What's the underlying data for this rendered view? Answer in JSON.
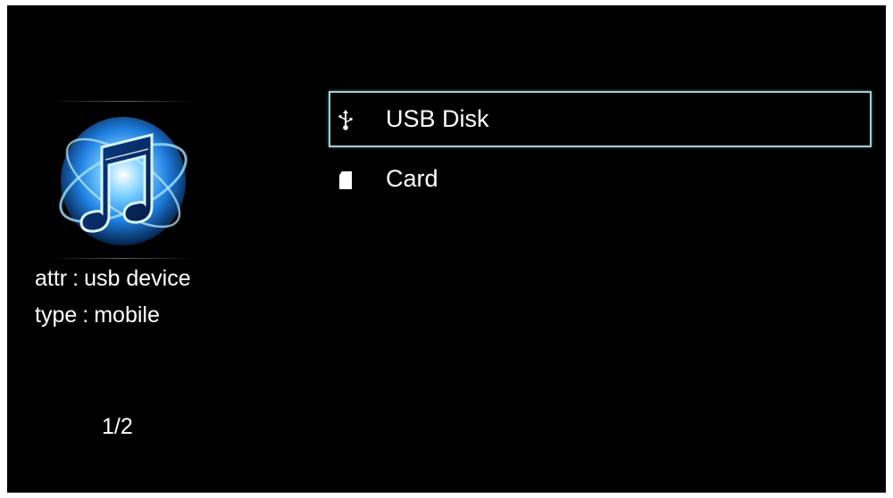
{
  "info": {
    "attr_key": "attr",
    "attr_value": "usb device",
    "type_key": "type",
    "type_value": "mobile",
    "separator": ":"
  },
  "pagination": {
    "label": "1/2"
  },
  "devices": [
    {
      "label": "USB Disk",
      "icon": "usb-icon",
      "selected": true
    },
    {
      "label": "Card",
      "icon": "sd-card-icon",
      "selected": false
    }
  ],
  "colors": {
    "background": "#000000",
    "text": "#ffffff",
    "selection_border": "#9fd0d8",
    "icon_glow": "#2fa8ff"
  }
}
